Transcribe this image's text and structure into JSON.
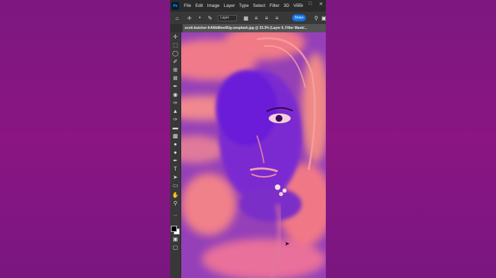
{
  "app": {
    "logo": "Ps",
    "menu": [
      "File",
      "Edit",
      "Image",
      "Layer",
      "Type",
      "Select",
      "Filter",
      "3D",
      "View"
    ]
  },
  "options_bar": {
    "layer_select": "Layer",
    "share_label": "Share"
  },
  "document": {
    "tab_title": "scott-butcher-frANbl8me9Ug-unsplash.jpg @ 33.3% (Layer 0, Filter Mask/..."
  },
  "toolbar": {
    "tools": [
      "move-tool",
      "marquee-tool",
      "lasso-tool",
      "quick-select-tool",
      "crop-tool",
      "frame-tool",
      "eyedropper-tool",
      "healing-brush-tool",
      "brush-tool",
      "clone-stamp-tool",
      "history-brush-tool",
      "eraser-tool",
      "gradient-tool",
      "blur-tool",
      "dodge-tool",
      "pen-tool",
      "type-tool",
      "path-select-tool",
      "shape-tool",
      "hand-tool",
      "zoom-tool"
    ]
  },
  "colors": {
    "background": "#84167f",
    "menubar": "#2b2b2b",
    "panel": "#383838",
    "accent": "#1473e6",
    "canvas_pink": "#f07a86",
    "canvas_purple": "#8a2bd8"
  }
}
